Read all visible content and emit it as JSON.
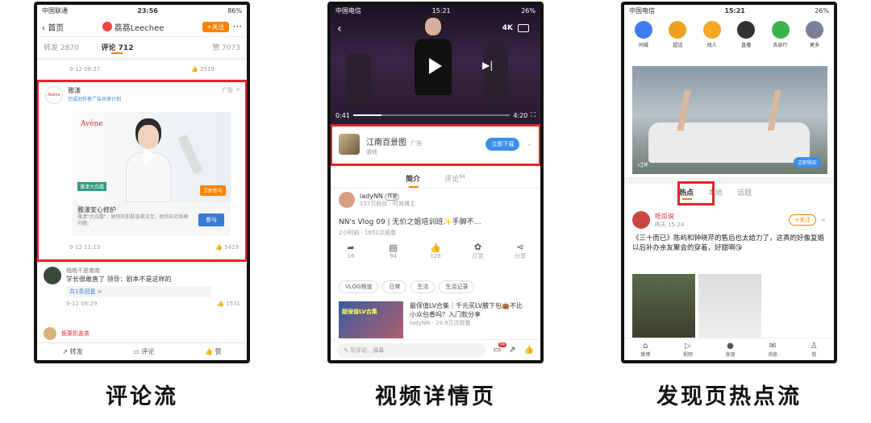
{
  "p1": {
    "status": {
      "carrier": "中国联通",
      "time": "23:56",
      "battery": "86%"
    },
    "nav": {
      "back": "首页",
      "name": "荔荔Leechee",
      "follow": "+关注"
    },
    "tabs": {
      "repost": "转发 2870",
      "comment": "评论 712",
      "like": "赞 7073"
    },
    "prev_item": {
      "date": "9-12 08:27",
      "likes": "2519"
    },
    "ad": {
      "brand": "雅漾",
      "subtitle": "完成创作者广告共享计划",
      "tag": "广告",
      "logo": "Avène",
      "title": "雅漾安心修护",
      "desc": "雅漾\"大白霜\"，屏你的肌肤急救法宝，助你应对各种问题。",
      "cta": "参与",
      "cta2": "立即参与",
      "date": "9-12 11:13",
      "likes": "5419",
      "poster_tag": "雅漾大白霜"
    },
    "c1": {
      "name": "梢梢不是南南",
      "text": "学长很敢直了 领导：剧本不是这样的",
      "reply": "共1条回复 >",
      "date": "9-12 08:29",
      "likes": "1531"
    },
    "c2": {
      "name": "板栗奶盖茶"
    },
    "bottom": {
      "repost": "转发",
      "comment": "评论",
      "like": "赞"
    },
    "caption": "评论流"
  },
  "p2": {
    "status": {
      "carrier": "中国电信",
      "time": "15:21",
      "battery": "26%"
    },
    "video": {
      "time": "0:41",
      "dur": "4:20",
      "quality": "4K"
    },
    "ad": {
      "name": "江南百景图",
      "tag": "广告",
      "sub": "游戏",
      "cta": "立即下载"
    },
    "tabs": {
      "intro": "简介",
      "comment": "评论",
      "count": "94"
    },
    "author": {
      "name": "ladyNN",
      "badge": "作者",
      "stats": "157万粉丝 · 时尚博主"
    },
    "title": "NN's Vlog 09 | 无价之姐培训班✨手脚不…",
    "meta": "2小时前 · 1652次观看",
    "actions": [
      {
        "n": "16",
        "icon": "share-icon"
      },
      {
        "n": "94",
        "icon": "comment-icon"
      },
      {
        "n": "128",
        "icon": "like-icon"
      },
      {
        "n": "打赏",
        "icon": "reward-icon"
      },
      {
        "n": "分享",
        "icon": "forward-icon"
      }
    ],
    "tags": [
      "VLOG频道",
      "日常",
      "生活",
      "生活记录"
    ],
    "rec": {
      "title": "最保值LV合集｜千元买LV腋下包👜不比小众包香吗？入门款分享",
      "meta": "ladyNN · 24.9万次观看",
      "thumb": "超保值LV合集"
    },
    "input": {
      "placeholder": "写评论、弹幕",
      "badge": "94"
    },
    "caption": "视频详情页"
  },
  "p3": {
    "status": {
      "carrier": "中国电信",
      "time": "15:21",
      "battery": "26%"
    },
    "icons": [
      {
        "label": "同城",
        "color": "#3d7df0",
        "icon": "city-icon"
      },
      {
        "label": "超话",
        "color": "#f0a020",
        "icon": "topic-icon"
      },
      {
        "label": "找人",
        "color": "#f5a623",
        "icon": "people-icon"
      },
      {
        "label": "直播",
        "color": "#333333",
        "icon": "live-icon"
      },
      {
        "label": "去旅行",
        "color": "#3bb34a",
        "icon": "travel-icon"
      },
      {
        "label": "更多",
        "color": "#7a7f9a",
        "icon": "more-icon"
      }
    ],
    "banner_cta": "立即购买",
    "tabs": [
      "热点",
      "本地",
      "话题"
    ],
    "post": {
      "name": "吃瓜说",
      "time": "昨天 15:24",
      "follow": "+关注",
      "text": "《三十而已》陈屿和钟晓芹的售后也太给力了，这真的好像复婚以后补办亲友聚会的穿着，好甜啊😘"
    },
    "nav": [
      "微博",
      "视频",
      "发现",
      "消息",
      "我"
    ],
    "caption": "发现页热点流"
  }
}
